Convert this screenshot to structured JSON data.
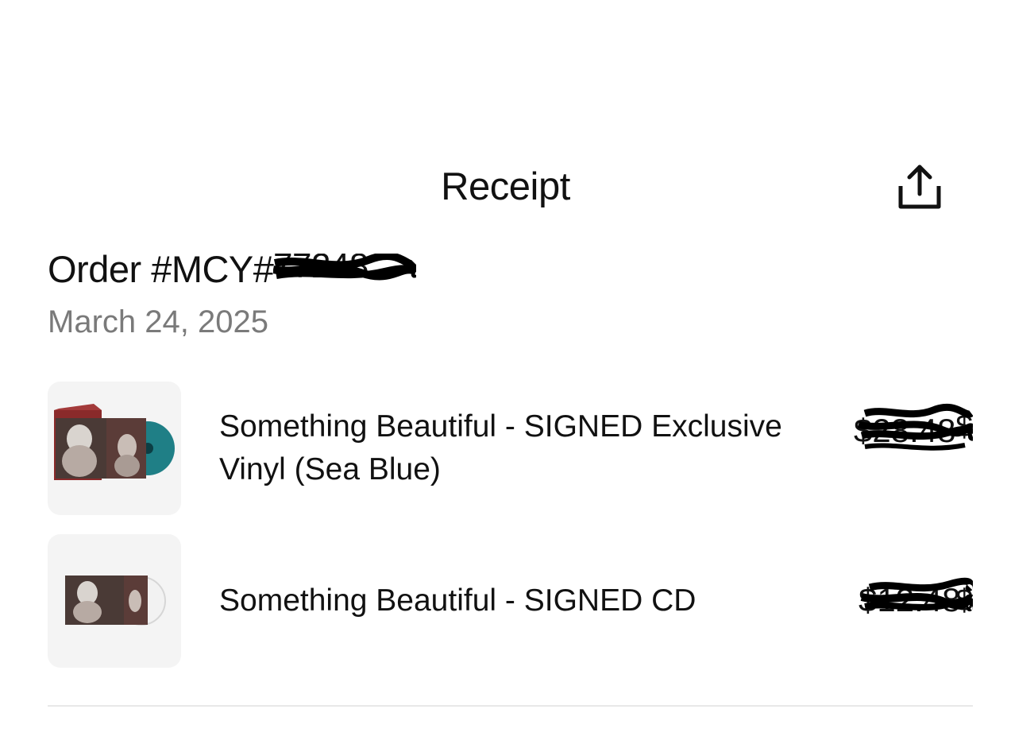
{
  "header": {
    "title": "Receipt",
    "share_icon": "share-icon"
  },
  "order": {
    "number_prefix": "Order #MCY#",
    "number_redacted_suffix": "77248",
    "date": "March 24, 2025"
  },
  "items": [
    {
      "title": "Something Beautiful - SIGNED Exclusive Vinyl (Sea Blue)",
      "price": "$",
      "price_redacted": true,
      "thumbnail": "vinyl-product-image",
      "vinyl_color": "#1f7f86"
    },
    {
      "title": "Something Beautiful - SIGNED CD",
      "price": "$",
      "price_redacted": true,
      "thumbnail": "cd-product-image"
    }
  ],
  "colors": {
    "text": "#111111",
    "muted": "#7a7a7a",
    "thumb_bg": "#f4f4f4",
    "divider": "#e8e8e8"
  }
}
